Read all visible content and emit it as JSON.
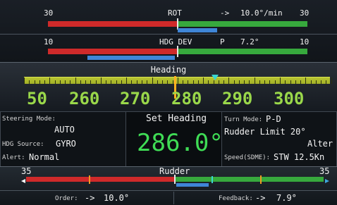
{
  "rot": {
    "scale_left": "30",
    "label": "ROT",
    "arrow": "->",
    "value": "10.0°/min",
    "scale_right": "30"
  },
  "hdg_dev": {
    "scale_left": "10",
    "label": "HDG DEV",
    "side": "P",
    "value": "7.2°",
    "scale_right": "10"
  },
  "heading": {
    "title": "Heading",
    "scale_numbers": [
      "50",
      "260",
      "270",
      "280",
      "290",
      "300"
    ]
  },
  "steering": {
    "mode_label": "Steering Mode:",
    "mode_value": "AUTO",
    "source_label": "HDG Source:",
    "source_value": "GYRO",
    "alert_label": "Alert:",
    "alert_value": "Normal"
  },
  "set_heading": {
    "title": "Set Heading",
    "value": "286.0°"
  },
  "turn": {
    "mode_label": "Turn Mode:",
    "mode_value": "P-D",
    "rudder_limit": "Rudder Limit 20°",
    "alter": "Alter",
    "speed_label": "Speed(SDME):",
    "speed_value": "STW 12.5Kn"
  },
  "rudder": {
    "scale_left": "35",
    "title": "Rudder",
    "scale_right": "35",
    "order_label": "Order:",
    "order_arrow": "->",
    "order_value": "10.0°",
    "feedback_label": "Feedback:",
    "feedback_arrow": "->",
    "feedback_value": "7.9°"
  },
  "colors": {
    "port": "#cf2a2a",
    "starboard": "#37a93d",
    "indicator": "#3f86d8",
    "heading_tape": "#b7c430",
    "set_heading_digits": "#3fdc55"
  }
}
